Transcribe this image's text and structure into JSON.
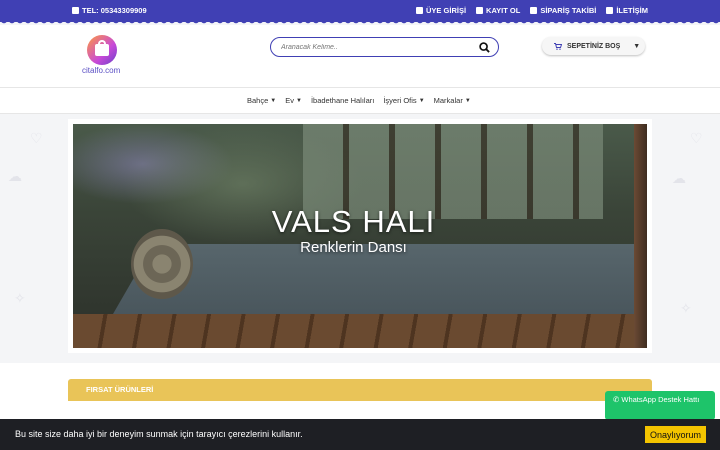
{
  "topbar": {
    "phone": "TEL: 05343309909",
    "links": [
      "ÜYE GİRİŞİ",
      "KAYIT OL",
      "SİPARİŞ TAKİBİ",
      "İLETİŞİM"
    ]
  },
  "header": {
    "logo_text": "citalfo.com",
    "search_placeholder": "Aranacak Kelime..",
    "cart_label": "SEPETİNİZ BOŞ"
  },
  "nav": {
    "items": [
      {
        "label": "Bahçe",
        "dropdown": true
      },
      {
        "label": "Ev",
        "dropdown": true
      },
      {
        "label": "İbadethane Halıları",
        "dropdown": false
      },
      {
        "label": "İşyeri Ofis",
        "dropdown": true
      },
      {
        "label": "Markalar",
        "dropdown": true
      }
    ]
  },
  "hero": {
    "title": "VALS HALI",
    "subtitle": "Renklerin Dansı"
  },
  "deals": {
    "title": "FIRSAT ÜRÜNLERİ"
  },
  "whatsapp": {
    "label": "WhatsApp Destek Hattı"
  },
  "cookie": {
    "message": "Bu site size daha iyi bir deneyim sunmak için tarayıcı çerezlerini kullanır.",
    "accept_label": "Onaylıyorum"
  },
  "colors": {
    "brand": "#4040b4",
    "deals": "#e9c458",
    "whatsapp": "#1ec46a",
    "cookie_accept": "#f4c400"
  }
}
